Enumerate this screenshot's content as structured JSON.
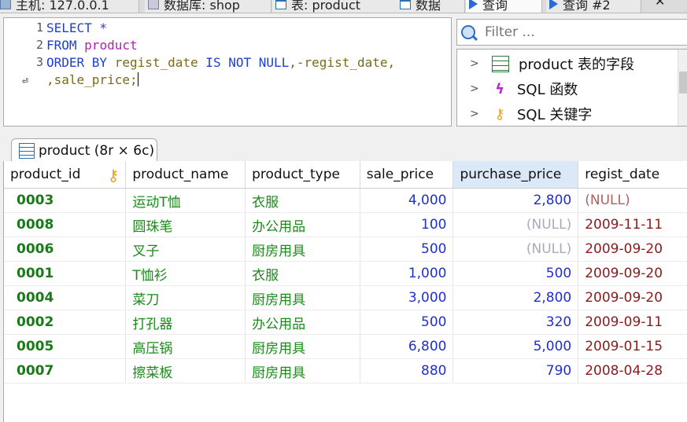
{
  "top_tabs": [
    {
      "label": "主机: 127.0.0.1",
      "icon": "host-icon"
    },
    {
      "label": "数据库: shop",
      "icon": "database-icon"
    },
    {
      "label": "表: product",
      "icon": "table-icon"
    },
    {
      "label": "数据",
      "icon": "table-icon"
    },
    {
      "label": "查询",
      "icon": "play-icon"
    },
    {
      "label": "查询 #2",
      "icon": "play-icon"
    }
  ],
  "close_symbol": "✕",
  "editor": {
    "line_numbers": [
      "1",
      "2",
      "3"
    ],
    "lines": {
      "l1_kw": "SELECT *",
      "l2_kw": "FROM ",
      "l2_ident": "product",
      "l3_kw1": "ORDER BY ",
      "l3_col1": "regist_date",
      "l3_kw2": " IS NOT NULL",
      "l3_rest": ",-regist_date,",
      "l4_rest": ",sale_price;"
    }
  },
  "filter": {
    "placeholder": "Filter ..."
  },
  "tree": [
    {
      "label": "product 表的字段",
      "icon": "table-icon"
    },
    {
      "label": "SQL 函数",
      "icon": "function-icon"
    },
    {
      "label": "SQL 关键字",
      "icon": "key-icon"
    }
  ],
  "result_tab": {
    "label": "product (8r × 6c)"
  },
  "columns": [
    "product_id",
    "product_name",
    "product_type",
    "sale_price",
    "purchase_price",
    "regist_date"
  ],
  "rows": [
    [
      "0003",
      "运动T恤",
      "衣服",
      "4,000",
      "2,800",
      "(NULL)"
    ],
    [
      "0008",
      "圆珠笔",
      "办公用品",
      "100",
      "(NULL)",
      "2009-11-11"
    ],
    [
      "0006",
      "叉子",
      "厨房用具",
      "500",
      "(NULL)",
      "2009-09-20"
    ],
    [
      "0001",
      "T恤衫",
      "衣服",
      "1,000",
      "500",
      "2009-09-20"
    ],
    [
      "0004",
      "菜刀",
      "厨房用具",
      "3,000",
      "2,800",
      "2009-09-20"
    ],
    [
      "0002",
      "打孔器",
      "办公用品",
      "500",
      "320",
      "2009-09-11"
    ],
    [
      "0005",
      "高压锅",
      "厨房用具",
      "6,800",
      "5,000",
      "2009-01-15"
    ],
    [
      "0007",
      "擦菜板",
      "厨房用具",
      "880",
      "790",
      "2008-04-28"
    ]
  ],
  "colors": {
    "keyword": "#1f3fd1",
    "identifier": "#b91fb3",
    "id_text": "#1a7a1a",
    "number": "#1f2fd1",
    "date": "#8b1a1a"
  }
}
